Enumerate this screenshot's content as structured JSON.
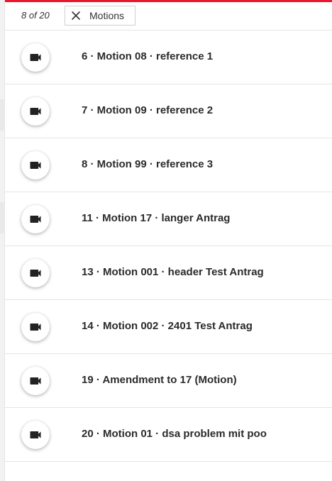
{
  "filter": {
    "count_text": "8 of 20",
    "chip_label": "Motions",
    "chip_icon": "close-icon"
  },
  "list": {
    "item_icon": "videocam-icon",
    "items": [
      {
        "title": "6 · Motion 08 · reference 1"
      },
      {
        "title": "7 · Motion 09 · reference 2"
      },
      {
        "title": "8 · Motion 99 · reference 3"
      },
      {
        "title": "11 · Motion 17 · langer Antrag"
      },
      {
        "title": "13 · Motion 001 · header Test Antrag"
      },
      {
        "title": "14 · Motion 002 · 2401 Test Antrag"
      },
      {
        "title": "19 · Amendment to 17 (Motion)"
      },
      {
        "title": "20 · Motion 01 · dsa problem mit poo"
      }
    ]
  },
  "colors": {
    "accent": "#e8172b",
    "text": "#2b2b2b",
    "divider": "#e4e4e4"
  }
}
